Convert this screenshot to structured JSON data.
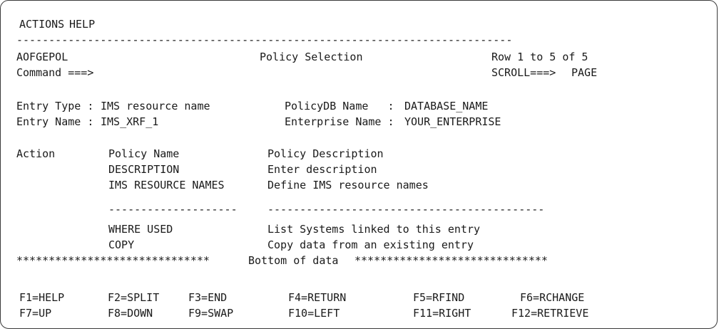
{
  "menu": {
    "actions": "ACTIONS",
    "help": "HELP"
  },
  "header": {
    "panel_id": "AOFGEPOL",
    "title": "Policy Selection",
    "row_info": "Row 1 to 5 of 5",
    "command_label": "Command ===>",
    "command_value": "",
    "scroll_label": "SCROLL===>",
    "scroll_value": "PAGE"
  },
  "entry": {
    "type_label": "Entry Type :",
    "type_value": "IMS resource name",
    "name_label": "Entry Name :",
    "name_value": "IMS_XRF_1",
    "policydb_label": "PolicyDB Name   :",
    "policydb_value": "DATABASE_NAME",
    "enterprise_label": "Enterprise Name :",
    "enterprise_value": "YOUR_ENTERPRISE"
  },
  "table": {
    "headers": {
      "action": "Action",
      "policy_name": "Policy Name",
      "policy_description": "Policy Description"
    },
    "rows": [
      {
        "name": "DESCRIPTION",
        "description": "Enter description"
      },
      {
        "name": "IMS RESOURCE NAMES",
        "description": "Define IMS resource names"
      },
      {
        "name": "WHERE USED",
        "description": "List Systems linked to this entry"
      },
      {
        "name": "COPY",
        "description": "Copy data from an existing entry"
      }
    ],
    "separator_name": "--------------------",
    "separator_desc": "-------------------------------------------",
    "bottom_left": "******************************",
    "bottom_text": "Bottom of data",
    "bottom_right": "******************************"
  },
  "top_rule": "-----------------------------------------------------------------------------",
  "function_keys": [
    {
      "label": "F1=HELP"
    },
    {
      "label": "F2=SPLIT"
    },
    {
      "label": "F3=END"
    },
    {
      "label": "F4=RETURN"
    },
    {
      "label": "F5=RFIND"
    },
    {
      "label": "F6=RCHANGE"
    },
    {
      "label": "F7=UP"
    },
    {
      "label": "F8=DOWN"
    },
    {
      "label": "F9=SWAP"
    },
    {
      "label": "F10=LEFT"
    },
    {
      "label": "F11=RIGHT"
    },
    {
      "label": "F12=RETRIEVE"
    }
  ]
}
